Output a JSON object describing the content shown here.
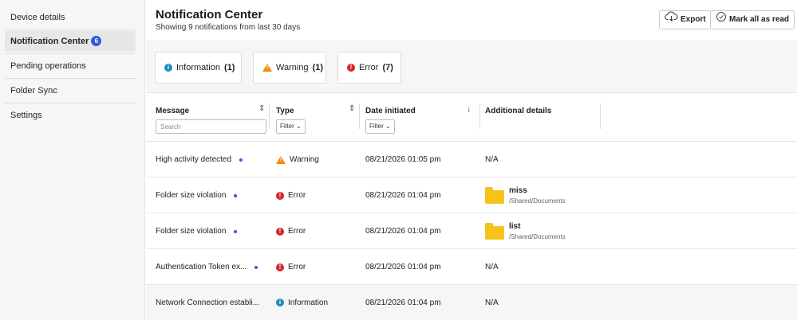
{
  "sidebar": {
    "items": [
      {
        "label": "Device details"
      },
      {
        "label": "Notification Center",
        "badge": "6"
      },
      {
        "label": "Pending operations"
      },
      {
        "label": "Folder Sync"
      },
      {
        "label": "Settings"
      }
    ]
  },
  "header": {
    "title": "Notification Center",
    "subtitle": "Showing 9 notifications from last 30 days",
    "export_label": "Export",
    "mark_all_label": "Mark all as read"
  },
  "filters": [
    {
      "label": "Information",
      "count": "(1)",
      "icon": "info-icon"
    },
    {
      "label": "Warning",
      "count": "(1)",
      "icon": "warning-icon"
    },
    {
      "label": "Error",
      "count": "(7)",
      "icon": "error-icon"
    }
  ],
  "table": {
    "columns": {
      "message": "Message",
      "type": "Type",
      "date": "Date initiated",
      "details": "Additional details"
    },
    "search_placeholder": "Search",
    "filter_label": "Filter",
    "rows": [
      {
        "message": "High activity detected",
        "type": "Warning",
        "type_icon": "warning-icon",
        "date": "08/21/2026 01:05 pm",
        "details": "N/A",
        "unread": true
      },
      {
        "message": "Folder size violation",
        "type": "Error",
        "type_icon": "error-icon",
        "date": "08/21/2026 01:04 pm",
        "folder_name": "miss",
        "folder_path": "/Shared/Documents",
        "unread": true
      },
      {
        "message": "Folder size violation",
        "type": "Error",
        "type_icon": "error-icon",
        "date": "08/21/2026 01:04 pm",
        "folder_name": "list",
        "folder_path": "/Shared/Documents",
        "unread": true
      },
      {
        "message": "Authentication Token ex...",
        "type": "Error",
        "type_icon": "error-icon",
        "date": "08/21/2026 01:04 pm",
        "details": "N/A",
        "unread": true
      },
      {
        "message": "Network Connection establi...",
        "type": "Information",
        "type_icon": "info-icon",
        "date": "08/21/2026 01:04 pm",
        "details": "N/A",
        "unread": false
      }
    ]
  },
  "colors": {
    "accent": "#2f5be0",
    "info": "#1a8db8",
    "warning": "#f08a0c",
    "error": "#d9252e",
    "folder": "#f8c21c"
  }
}
